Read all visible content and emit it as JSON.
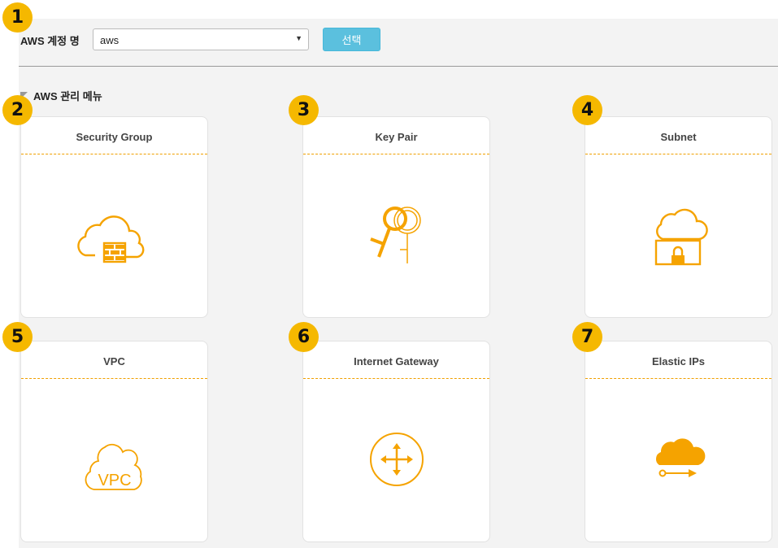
{
  "account": {
    "label": "AWS 계정 명",
    "selected": "aws",
    "select_button": "선택"
  },
  "menu": {
    "title": "AWS 관리 메뉴",
    "cards": [
      {
        "badge": "2",
        "title": "Security Group",
        "icon": "cloud-firewall-icon"
      },
      {
        "badge": "3",
        "title": "Key Pair",
        "icon": "key-pair-icon"
      },
      {
        "badge": "4",
        "title": "Subnet",
        "icon": "subnet-lock-icon"
      },
      {
        "badge": "5",
        "title": "VPC",
        "icon": "vpc-cloud-icon"
      },
      {
        "badge": "6",
        "title": "Internet Gateway",
        "icon": "gateway-arrows-icon"
      },
      {
        "badge": "7",
        "title": "Elastic IPs",
        "icon": "elastic-ip-cloud-icon"
      }
    ]
  },
  "badges": {
    "account": "1"
  },
  "colors": {
    "accent": "#f5a300",
    "badge": "#f5b800",
    "button": "#5bc0de"
  }
}
